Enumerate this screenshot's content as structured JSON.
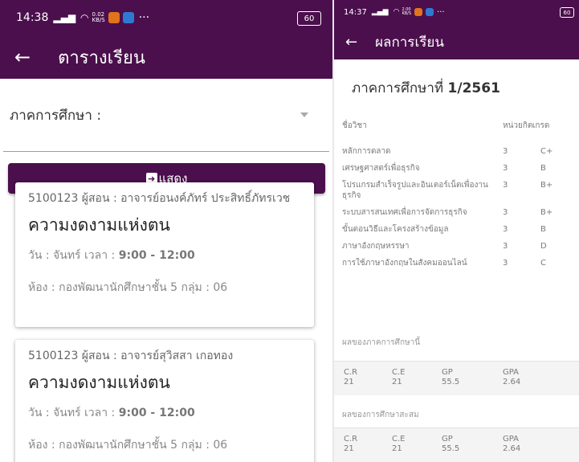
{
  "left": {
    "status": {
      "time": "14:38",
      "net_speed": "0.02",
      "net_unit": "KB/S",
      "extra": "···",
      "battery": "60"
    },
    "appbar": {
      "title": "ตารางเรียน"
    },
    "term": {
      "label": "ภาคการศึกษา :"
    },
    "show_button": {
      "label": "แสดง"
    },
    "cards": [
      {
        "teacher": "5100123 ผู้สอน : อาจารย์อนงค์ภัทร์ ประสิทธิ์ภัทรเวช",
        "subject": "ความงดงามแห่งตน",
        "day_label": "วัน : จันทร์ เวลา : ",
        "time": "9:00 - 12:00",
        "room": "ห้อง : กองพัฒนานักศึกษาชั้น 5 กลุ่ม : 06"
      },
      {
        "teacher": "5100123 ผู้สอน : อาจารย์สุวิสสา เกอทอง",
        "subject": "ความงดงามแห่งตน",
        "day_label": "วัน : จันทร์ เวลา : ",
        "time": "9:00 - 12:00",
        "room": "ห้อง : กองพัฒนานักศึกษาชั้น 5 กลุ่ม : 06"
      }
    ]
  },
  "right": {
    "status": {
      "time": "14:37",
      "net_speed": "2.00",
      "net_unit": "KB/S",
      "extra": "···",
      "battery": "60"
    },
    "appbar": {
      "title": "ผลการเรียน"
    },
    "semester": {
      "prefix": "ภาคการศึกษาที่ ",
      "value": "1/2561"
    },
    "columns": {
      "subject": "ชื่อวิชา",
      "credit": "หน่วยกิต",
      "grade": "เกรด"
    },
    "rows": [
      {
        "subject": "หลักการตลาด",
        "credit": "3",
        "grade": "C+"
      },
      {
        "subject": "เศรษฐศาสตร์เพื่อธุรกิจ",
        "credit": "3",
        "grade": "B"
      },
      {
        "subject": "โปรแกรมสำเร็จรูปและอินเตอร์เน็ตเพื่องานธุรกิจ",
        "credit": "3",
        "grade": "B+"
      },
      {
        "subject": "ระบบสารสนเทศเพื่อการจัดการธุรกิจ",
        "credit": "3",
        "grade": "B+"
      },
      {
        "subject": "ขั้นตอนวิธีและโครงสร้างข้อมูล",
        "credit": "3",
        "grade": "B"
      },
      {
        "subject": "ภาษาอังกฤษหรรษา",
        "credit": "3",
        "grade": "D"
      },
      {
        "subject": "การใช้ภาษาอังกฤษในสังคมออนไลน์",
        "credit": "3",
        "grade": "C"
      }
    ],
    "term_result": {
      "label": "ผลของภาคการศึกษานี้",
      "cr_label": "C.R",
      "ce_label": "C.E",
      "gp_label": "GP",
      "gpa_label": "GPA",
      "cr": "21",
      "ce": "21",
      "gp": "55.5",
      "gpa": "2.64"
    },
    "cumulative": {
      "label": "ผลของการศึกษาสะสม",
      "cr_label": "C.R",
      "ce_label": "C.E",
      "gp_label": "GP",
      "gpa_label": "GPA",
      "cr": "21",
      "ce": "21",
      "gp": "55.5",
      "gpa": "2.64"
    }
  },
  "colors": {
    "primary": "#4b0f4d",
    "card_bg": "#ffffff",
    "muted_text": "#888888"
  }
}
